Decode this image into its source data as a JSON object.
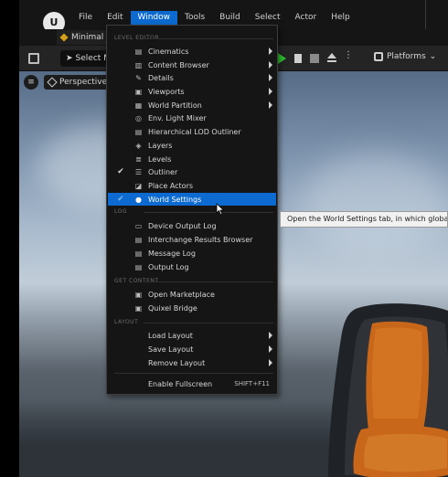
{
  "menubar": {
    "logo": "U",
    "items": [
      "File",
      "Edit",
      "Window",
      "Tools",
      "Build",
      "Select",
      "Actor",
      "Help"
    ],
    "active": "Window"
  },
  "tab": {
    "label": "Minimal"
  },
  "toolbar": {
    "select_mode": "Select M",
    "platforms": "Platforms"
  },
  "viewport": {
    "perspective": "Perspective"
  },
  "window_menu": {
    "sections": {
      "level_editor": "LEVEL EDITOR",
      "log": "LOG",
      "get_content": "GET CONTENT",
      "layout": "LAYOUT"
    },
    "level_editor_items": [
      {
        "label": "Cinematics",
        "icon": "cinematics-icon",
        "submenu": true
      },
      {
        "label": "Content Browser",
        "icon": "content-browser-icon",
        "submenu": true
      },
      {
        "label": "Details",
        "icon": "details-icon",
        "submenu": true
      },
      {
        "label": "Viewports",
        "icon": "viewports-icon",
        "submenu": true
      },
      {
        "label": "World Partition",
        "icon": "world-partition-icon",
        "submenu": true
      },
      {
        "label": "Env. Light Mixer",
        "icon": "light-mixer-icon",
        "submenu": false
      },
      {
        "label": "Hierarchical LOD Outliner",
        "icon": "lod-outliner-icon",
        "submenu": false
      },
      {
        "label": "Layers",
        "icon": "layers-icon",
        "submenu": false
      },
      {
        "label": "Levels",
        "icon": "levels-icon",
        "submenu": false
      },
      {
        "label": "Outliner",
        "icon": "outliner-icon",
        "submenu": false,
        "checked": true
      },
      {
        "label": "Place Actors",
        "icon": "place-actors-icon",
        "submenu": false
      },
      {
        "label": "World Settings",
        "icon": "world-settings-icon",
        "submenu": false,
        "checked": true,
        "highlighted": true
      }
    ],
    "log_items": [
      {
        "label": "Device Output Log",
        "icon": "device-log-icon"
      },
      {
        "label": "Interchange Results Browser",
        "icon": "interchange-icon"
      },
      {
        "label": "Message Log",
        "icon": "message-log-icon"
      },
      {
        "label": "Output Log",
        "icon": "output-log-icon"
      }
    ],
    "get_content_items": [
      {
        "label": "Open Marketplace",
        "icon": "marketplace-icon"
      },
      {
        "label": "Quixel Bridge",
        "icon": "quixel-icon"
      }
    ],
    "layout_items": [
      {
        "label": "Load Layout",
        "submenu": true
      },
      {
        "label": "Save Layout",
        "submenu": true
      },
      {
        "label": "Remove Layout",
        "submenu": true
      }
    ],
    "fullscreen": {
      "label": "Enable Fullscreen",
      "shortcut": "SHIFT+F11"
    }
  },
  "tooltip": {
    "text": "Open the World Settings tab, in which global prop"
  },
  "colors": {
    "accent": "#0c6ad0",
    "menu_bg": "#151515",
    "play": "#2ec02e",
    "chair_orange": "#c8661a"
  }
}
